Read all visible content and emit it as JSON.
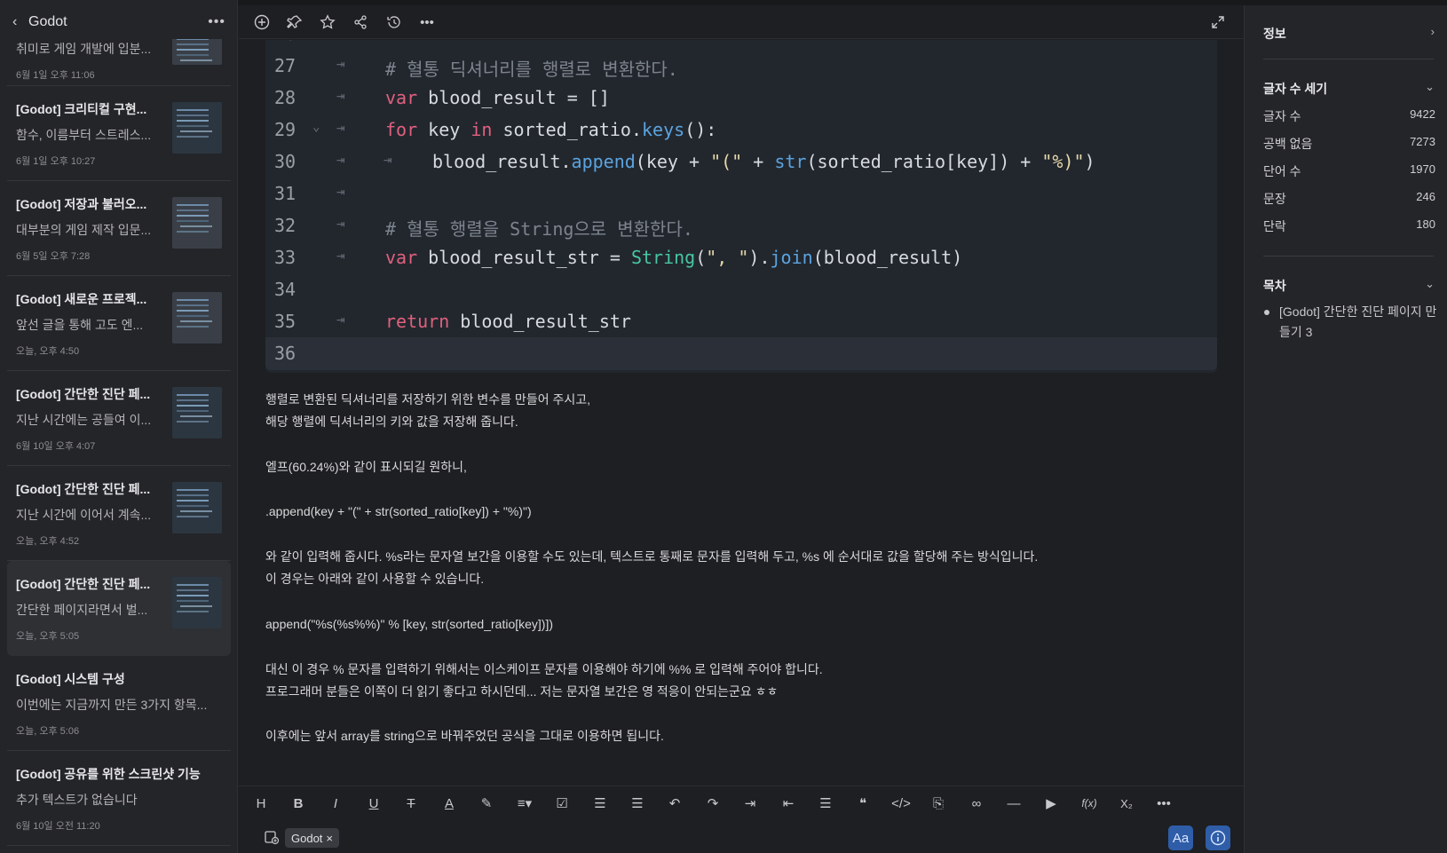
{
  "sidebar": {
    "folder_title": "Godot",
    "back_icon": "chevron-left-icon",
    "more_icon": "more-horizontal-icon",
    "notes": [
      {
        "title": "",
        "body": "취미로 게임 개발에 입분...",
        "date": "6월 1일 오후 11:06"
      },
      {
        "title": "[Godot] 크리티컬 구현...",
        "body": "함수, 이름부터 스트레스...",
        "date": "6월 1일 오후 10:27"
      },
      {
        "title": "[Godot] 저장과 불러오...",
        "body": "대부분의 게임 제작 입문...",
        "date": "6월 5일 오후 7:28"
      },
      {
        "title": "[Godot] 새로운 프로젝...",
        "body": "앞선 글을 통해 고도 엔...",
        "date": "오늘, 오후 4:50"
      },
      {
        "title": "[Godot] 간단한 진단 페...",
        "body": "지난 시간에는 공들여 이...",
        "date": "6월 10일 오후 4:07"
      },
      {
        "title": "[Godot] 간단한 진단 페...",
        "body": "지난 시간에 이어서 계속...",
        "date": "오늘, 오후 4:52"
      },
      {
        "title": "[Godot] 간단한 진단 페...",
        "body": "간단한 페이지라면서 벌...",
        "date": "오늘, 오후 5:05"
      },
      {
        "title": "[Godot] 시스템 구성",
        "body": "이번에는 지금까지 만든 3가지 항목...",
        "date": "오늘, 오후 5:06"
      },
      {
        "title": "[Godot] 공유를 위한 스크린샷 기능",
        "body": "추가 텍스트가 없습니다",
        "date": "6월 10일 오전 11:20"
      }
    ]
  },
  "topbar": {
    "icons": [
      "add-circle-icon",
      "pin-icon",
      "star-icon",
      "share-icon",
      "history-icon",
      "more-horizontal-icon",
      "expand-icon"
    ]
  },
  "code": {
    "lines": [
      {
        "n": "27"
      },
      {
        "n": "28"
      },
      {
        "n": "29"
      },
      {
        "n": "30"
      },
      {
        "n": "31"
      },
      {
        "n": "32"
      },
      {
        "n": "33"
      },
      {
        "n": "34"
      },
      {
        "n": "35"
      },
      {
        "n": "36"
      }
    ],
    "l27_comment": "# 혈통 딕셔너리를 행렬로 변환한다.",
    "l28_var": "var",
    "l28_rest": " blood_result = []",
    "l29_for": "for",
    "l29_a": " key ",
    "l29_in": "in",
    "l29_b": " sorted_ratio.",
    "l29_fn": "keys",
    "l29_c": "():",
    "l30_a": "blood_result.",
    "l30_fn": "append",
    "l30_b": "(key + ",
    "l30_s1": "\"(\"",
    "l30_c": " + ",
    "l30_str": "str",
    "l30_d": "(sorted_ratio[key]) + ",
    "l30_s2": "\"%)\"",
    "l30_e": ")",
    "l32_comment": "# 혈통 행렬을 String으로 변환한다.",
    "l33_var": "var",
    "l33_a": " blood_result_str = ",
    "l33_type": "String",
    "l33_b": "(",
    "l33_s": "\", \"",
    "l33_c": ").",
    "l33_fn": "join",
    "l33_d": "(blood_result)",
    "l35_ret": "return",
    "l35_rest": " blood_result_str"
  },
  "body": {
    "paragraphs": [
      "행렬로 변환된 딕셔너리를 저장하기 위한 변수를 만들어 주시고,",
      "해당 행렬에 딕셔너리의 키와 값을 저장해 줍니다.",
      "",
      "엘프(60.24%)와 같이 표시되길 원하니,",
      "",
      ".append(key + \"(\" + str(sorted_ratio[key]) + \"%)\")",
      "",
      "와 같이 입력해 줍시다. %s라는 문자열 보간을 이용할 수도 있는데, 텍스트로 통째로 문자를 입력해 두고, %s 에 순서대로 값을 할당해 주는 방식입니다.",
      "이 경우는 아래와 같이 사용할 수 있습니다.",
      "",
      "append(\"%s(%s%%)\" % [key, str(sorted_ratio[key])])",
      "",
      "대신 이 경우 % 문자를 입력하기 위해서는 이스케이프 문자를 이용해야 하기에 %% 로 입력해 주어야 합니다.",
      "프로그래머 분들은 이쪽이 더 읽기 좋다고 하시던데... 저는 문자열 보간은 영 적응이 안되는군요 ㅎㅎ",
      "",
      "이후에는 앞서 array를 string으로 바꿔주었던 공식을 그대로 이용하면 됩니다."
    ]
  },
  "format_bar": {
    "buttons": [
      {
        "label": "H",
        "icon": "heading-icon"
      },
      {
        "label": "B",
        "icon": "bold-icon"
      },
      {
        "label": "I",
        "icon": "italic-icon"
      },
      {
        "label": "U",
        "icon": "underline-icon"
      },
      {
        "label": "T",
        "icon": "strikethrough-icon"
      },
      {
        "label": "A",
        "icon": "text-color-icon"
      },
      {
        "label": "",
        "icon": "highlighter-icon"
      },
      {
        "label": "",
        "icon": "align-icon"
      },
      {
        "label": "",
        "icon": "checkbox-icon"
      },
      {
        "label": "",
        "icon": "bullet-list-icon"
      },
      {
        "label": "",
        "icon": "numbered-list-icon"
      },
      {
        "label": "",
        "icon": "undo-icon"
      },
      {
        "label": "",
        "icon": "redo-icon"
      },
      {
        "label": "",
        "icon": "indent-icon"
      },
      {
        "label": "",
        "icon": "outdent-icon"
      },
      {
        "label": "",
        "icon": "toggle-list-icon"
      },
      {
        "label": "",
        "icon": "quote-icon"
      },
      {
        "label": "",
        "icon": "code-icon"
      },
      {
        "label": "",
        "icon": "code-block-icon"
      },
      {
        "label": "",
        "icon": "link-icon"
      },
      {
        "label": "",
        "icon": "divider-icon"
      },
      {
        "label": "",
        "icon": "video-icon"
      },
      {
        "label": "f(x)",
        "icon": "formula-icon"
      },
      {
        "label": "X₂",
        "icon": "subscript-icon"
      },
      {
        "label": "",
        "icon": "more-horizontal-icon"
      }
    ]
  },
  "tags": {
    "tag_icon": "tag-add-icon",
    "tag_label": "Godot",
    "remove_glyph": "×",
    "aa_label": "Aa",
    "info_icon": "info-icon"
  },
  "right_panel": {
    "info_title": "정보",
    "word_count_title": "글자 수 세기",
    "stats": [
      {
        "label": "글자 수",
        "value": "9422"
      },
      {
        "label": "공백 없음",
        "value": "7273"
      },
      {
        "label": "단어 수",
        "value": "1970"
      },
      {
        "label": "문장",
        "value": "246"
      },
      {
        "label": "단락",
        "value": "180"
      }
    ],
    "toc_title": "목차",
    "toc_item": "[Godot] 간단한 진단 페이지 만들기 3"
  },
  "colors": {
    "accent": "#2f5da8",
    "keyword": "#e0607e",
    "function": "#5ba4e0",
    "type": "#48c6a2"
  }
}
